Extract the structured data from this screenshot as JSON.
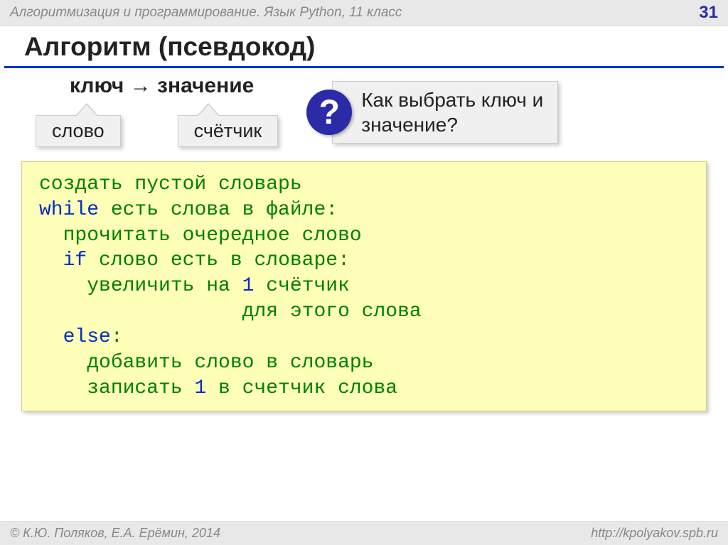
{
  "header": {
    "course": "Алгоритмизация и программирование. Язык Python, 11 класс",
    "page": "31"
  },
  "title": "Алгоритм (псевдокод)",
  "kv": {
    "key": "ключ",
    "arrow": "→",
    "value": "значение"
  },
  "callouts": {
    "word": "слово",
    "counter": "счётчик"
  },
  "question": {
    "mark": "?",
    "line1": "Как выбрать ключ и",
    "line2": "значение?"
  },
  "code": {
    "l1": "создать пустой словарь",
    "l2_kw": "while",
    "l2_rest": " есть слова в файле:",
    "l3": "  прочитать очередное слово",
    "l4_pad": "  ",
    "l4_kw": "if",
    "l4_rest": " слово есть в словаре:",
    "l5a": "    увеличить на ",
    "l5_num": "1",
    "l5b": " счётчик ",
    "l6": "                 для этого слова",
    "l7_pad": "  ",
    "l7_kw": "else",
    "l7_rest": ":",
    "l8": "    добавить слово в словарь",
    "l9a": "    записать ",
    "l9_num": "1",
    "l9b": " в счетчик слова"
  },
  "footer": {
    "author": "© К.Ю. Поляков, Е.А. Ерёмин, 2014",
    "url": "http://kpolyakov.spb.ru"
  }
}
